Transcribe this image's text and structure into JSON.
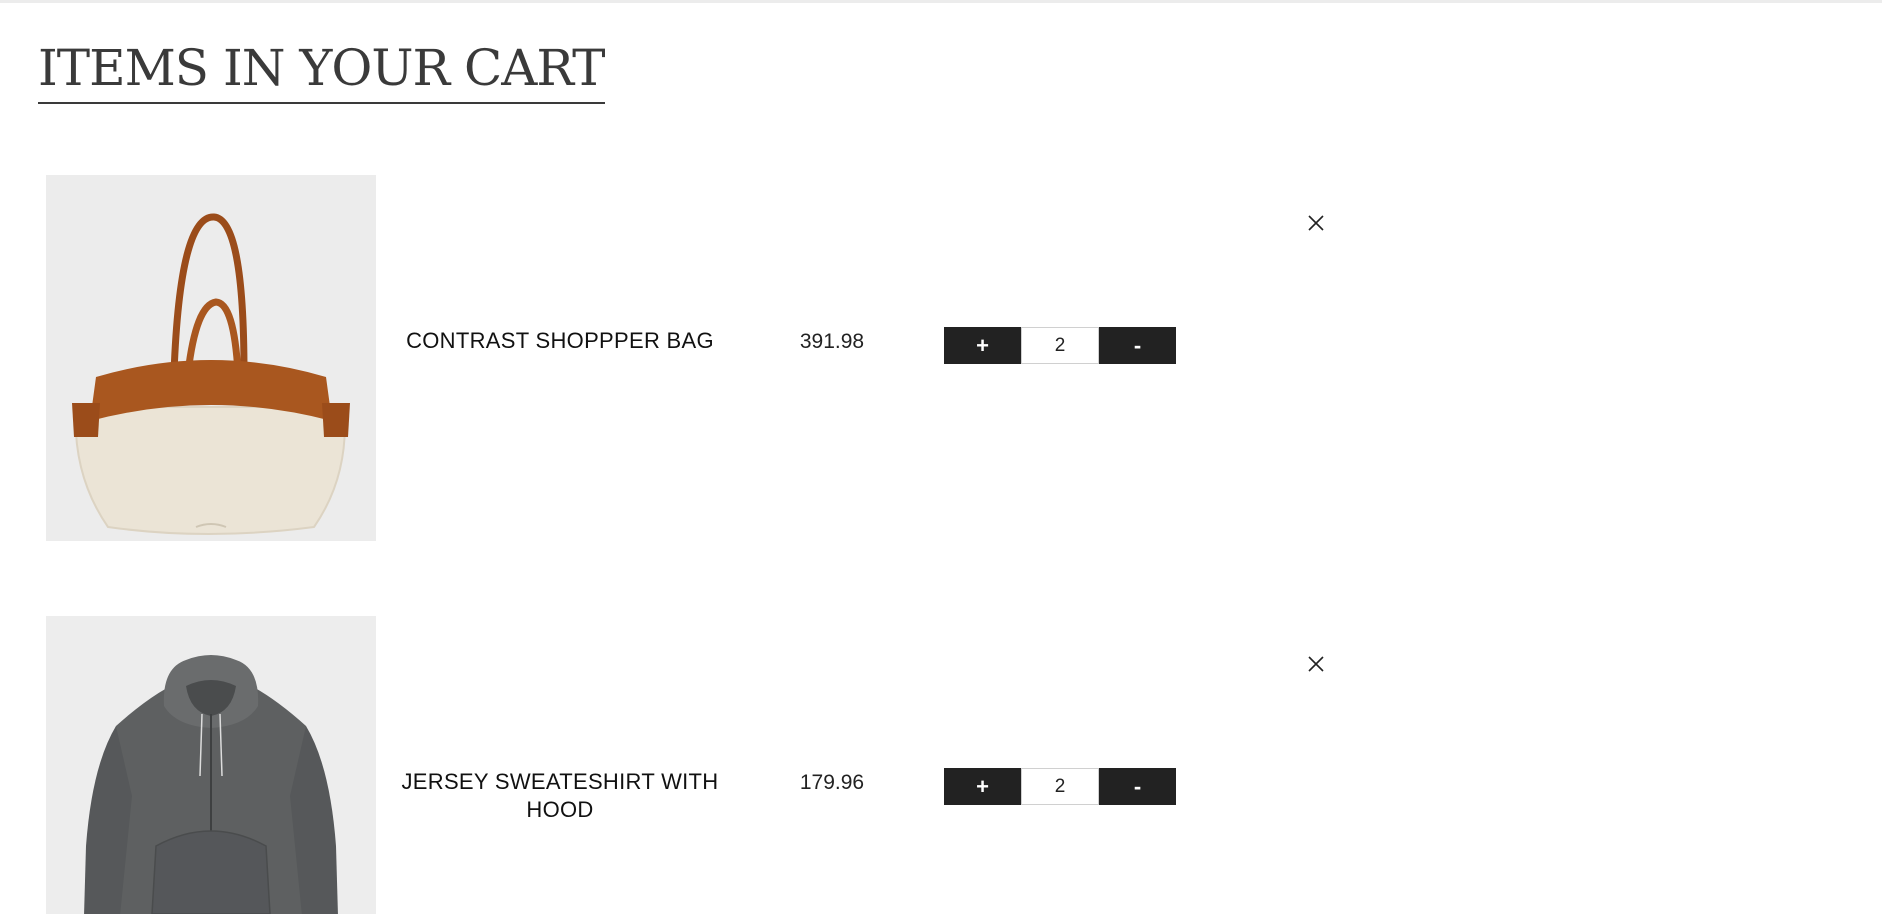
{
  "page": {
    "title": "ITEMS IN YOUR CART"
  },
  "cart": {
    "items": [
      {
        "name": "CONTRAST SHOPPPER BAG",
        "price": "391.98",
        "quantity": "2",
        "image_icon": "tote-bag-image",
        "increment_label": "+",
        "decrement_label": "-"
      },
      {
        "name": "JERSEY SWEATESHIRT WITH HOOD",
        "price": "179.96",
        "quantity": "2",
        "image_icon": "hoodie-image",
        "increment_label": "+",
        "decrement_label": "-"
      }
    ]
  },
  "colors": {
    "button_bg": "#222222",
    "title": "#3a3a3a",
    "image_bg": "#ececec",
    "leather": "#a9571f",
    "canvas": "#ebe4d6",
    "hoodie": "#5e6061"
  }
}
